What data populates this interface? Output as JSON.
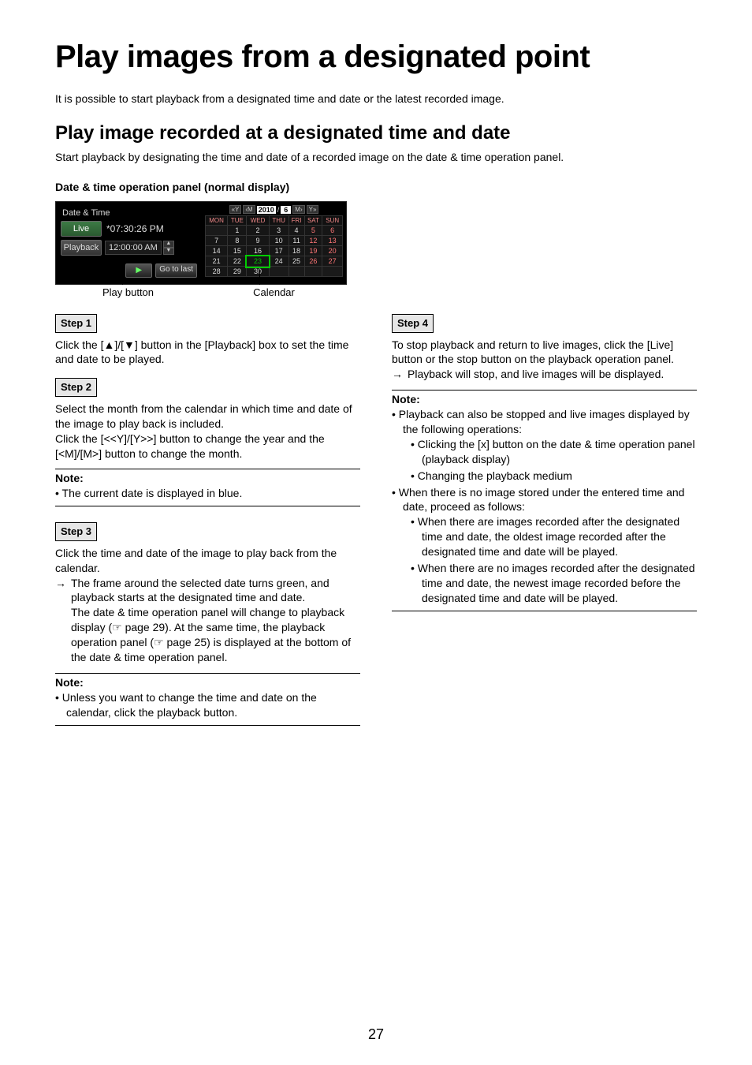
{
  "page_number": "27",
  "title": "Play images from a designated point",
  "intro": "It is possible to start playback from a designated time and date or the latest recorded image.",
  "section_title": "Play image recorded at a designated time and date",
  "sub_intro": "Start playback by designating the time and date of a recorded image on the date & time operation panel.",
  "panel_caption": "Date & time operation panel (normal display)",
  "panel": {
    "header": "Date & Time",
    "live_label": "Live",
    "live_value": "*07:30:26 PM",
    "playback_label": "Playback",
    "playback_value": "12:00:00 AM",
    "play_glyph": "▶",
    "go_to_last": "Go to last",
    "nav": {
      "yy_prev": "«Y",
      "m_prev": "‹M",
      "year": "2010",
      "sep": "/",
      "month": "6",
      "m_next": "M›",
      "yy_next": "Y»"
    },
    "dow": [
      "MON",
      "TUE",
      "WED",
      "THU",
      "FRI",
      "SAT",
      "SUN"
    ],
    "selected_day": "23",
    "callout_play": "Play button",
    "callout_calendar": "Calendar"
  },
  "left": {
    "step1_label": "Step 1",
    "step1_text": "Click the [▲]/[▼] button in the [Playback] box to set the time and date to be played.",
    "step2_label": "Step 2",
    "step2_text1": "Select the month from the calendar in which time and date of the image to play back is included.",
    "step2_text2": "Click the [<<Y]/[Y>>] button to change the year and the [<M]/[M>] button to change the month.",
    "note1_title": "Note:",
    "note1_b1": "The current date is displayed in blue.",
    "step3_label": "Step 3",
    "step3_text1": "Click the time and date of the image to play back from the calendar.",
    "step3_arrow": "→",
    "step3_arrow_text": "The frame around the selected date turns green, and playback starts at the designated time and date.",
    "step3_text3": "The date & time operation panel will change to playback display (☞ page 29). At the same time, the playback operation panel (☞ page 25) is displayed at the bottom of the date & time operation panel.",
    "note2_title": "Note:",
    "note2_b1": "Unless you want to change the time and date on the calendar, click the playback button."
  },
  "right": {
    "step4_label": "Step 4",
    "step4_text": "To stop playback and return to live images, click the [Live] button or the stop button on the playback operation panel.",
    "step4_arrow": "→",
    "step4_arrow_text": "Playback will stop, and live images will be displayed.",
    "note_title": "Note:",
    "b1": "Playback can also be stopped and live images displayed by the following operations:",
    "b1a": "Clicking the [x] button on the date & time operation panel (playback display)",
    "b1b": "Changing the playback medium",
    "b2": "When there is no image stored under the entered time and date, proceed as follows:",
    "b2a": "When there are images recorded after the designated time and date, the oldest image recorded after the designated time and date will be played.",
    "b2b": "When there are no images recorded after the designated time and date, the newest image recorded before the designated time and date will be played."
  }
}
